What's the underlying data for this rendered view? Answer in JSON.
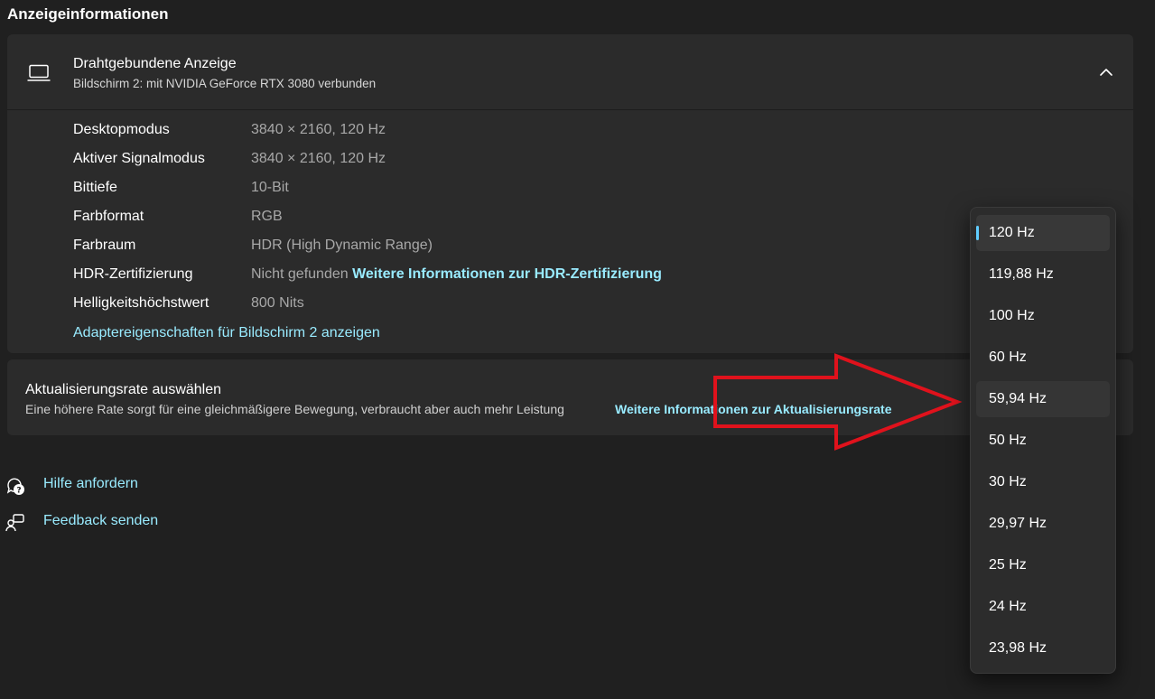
{
  "section": {
    "title": "Anzeigeinformationen"
  },
  "display": {
    "name": "Drahtgebundene Anzeige",
    "subtitle": "Bildschirm 2: mit NVIDIA GeForce RTX 3080 verbunden",
    "icon": "laptop-icon",
    "expanded_icon": "chevron-up-icon",
    "rows": [
      {
        "label": "Desktopmodus",
        "value": "3840 × 2160, 120 Hz",
        "link": ""
      },
      {
        "label": "Aktiver Signalmodus",
        "value": "3840 × 2160, 120 Hz",
        "link": ""
      },
      {
        "label": "Bittiefe",
        "value": "10-Bit",
        "link": ""
      },
      {
        "label": "Farbformat",
        "value": "RGB",
        "link": ""
      },
      {
        "label": "Farbraum",
        "value": "HDR (High Dynamic Range)",
        "link": ""
      },
      {
        "label": "HDR-Zertifizierung",
        "value": "Nicht gefunden",
        "link": "Weitere Informationen zur HDR-Zertifizierung"
      },
      {
        "label": "Helligkeitshöchstwert",
        "value": "800 Nits",
        "link": ""
      }
    ],
    "adapter_link": "Adaptereigenschaften für Bildschirm 2 anzeigen"
  },
  "refresh": {
    "title": "Aktualisierungsrate auswählen",
    "description": "Eine höhere Rate sorgt für eine gleichmäßigere Bewegung, verbraucht aber auch mehr Leistung",
    "link": "Weitere Informationen zur Aktualisierungsrate"
  },
  "help": [
    {
      "label": "Hilfe anfordern",
      "icon": "help-chat-icon"
    },
    {
      "label": "Feedback senden",
      "icon": "feedback-icon"
    }
  ],
  "dropdown": {
    "selected": "120 Hz",
    "highlighted": "59,94 Hz",
    "options": [
      "120 Hz",
      "119,88 Hz",
      "100 Hz",
      "60 Hz",
      "59,94 Hz",
      "50 Hz",
      "30 Hz",
      "29,97 Hz",
      "25 Hz",
      "24 Hz",
      "23,98 Hz"
    ]
  },
  "colors": {
    "background": "#202020",
    "card": "#2b2b2b",
    "link": "#99ebff",
    "accent": "#60cdff",
    "annotation_arrow": "#e0121c"
  }
}
